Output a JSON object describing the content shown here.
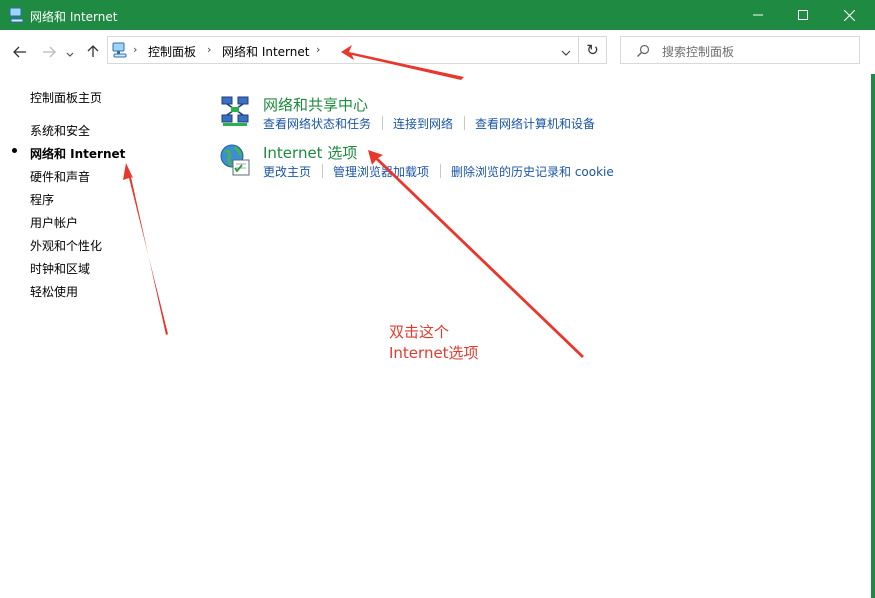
{
  "window": {
    "title": "网络和 Internet",
    "accent_color": "#1e8a42",
    "controls": [
      "minimize-icon",
      "maximize-icon",
      "close-icon"
    ]
  },
  "navigation": {
    "back_icon": "back-arrow-icon",
    "forward_icon": "forward-arrow-icon",
    "recent_icon": "chevron-down-icon",
    "up_icon": "up-arrow-icon"
  },
  "address": {
    "breadcrumbs": [
      "控制面板",
      "网络和 Internet"
    ],
    "separator": "›"
  },
  "search": {
    "placeholder": "搜索控制面板"
  },
  "sidebar": {
    "items": [
      {
        "label": "控制面板主页"
      },
      {
        "label": "系统和安全"
      },
      {
        "label": "网络和 Internet",
        "active": true
      },
      {
        "label": "硬件和声音"
      },
      {
        "label": "程序"
      },
      {
        "label": "用户帐户"
      },
      {
        "label": "外观和个性化"
      },
      {
        "label": "时钟和区域"
      },
      {
        "label": "轻松使用"
      }
    ]
  },
  "categories": [
    {
      "title": "网络和共享中心",
      "icon": "network-sharing-center-icon",
      "links": [
        "查看网络状态和任务",
        "连接到网络",
        "查看网络计算机和设备"
      ]
    },
    {
      "title": "Internet 选项",
      "icon": "internet-options-icon",
      "links": [
        "更改主页",
        "管理浏览器加载项",
        "删除浏览的历史记录和 cookie"
      ]
    }
  ],
  "annotation": {
    "text_line1": "双击这个",
    "text_line2": "Internet选项",
    "color": "#e23b2e"
  }
}
